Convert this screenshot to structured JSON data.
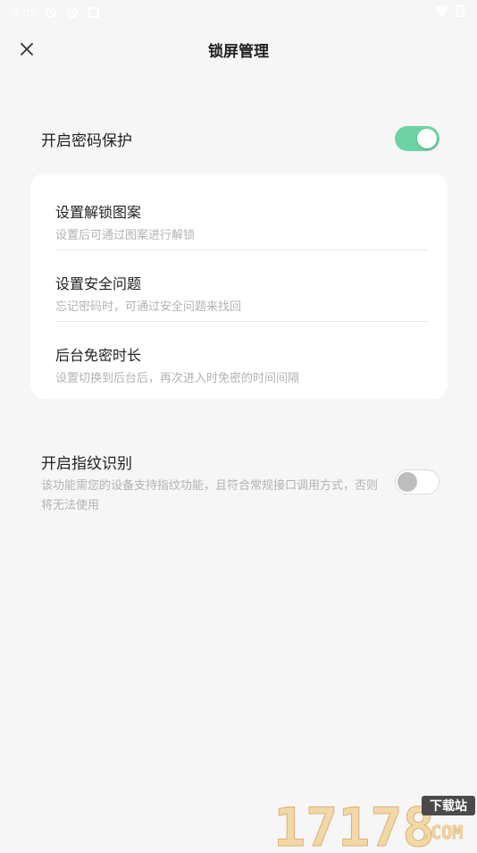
{
  "status_bar": {
    "time": "9:05"
  },
  "header": {
    "title": "锁屏管理"
  },
  "password_protection": {
    "label": "开启密码保护",
    "enabled": true
  },
  "card_items": [
    {
      "title": "设置解锁图案",
      "subtitle": "设置后可通过图案进行解锁"
    },
    {
      "title": "设置安全问题",
      "subtitle": "忘记密码时，可通过安全问题来找回"
    },
    {
      "title": "后台免密时长",
      "subtitle": "设置切换到后台后，再次进入时免密的时间间隔"
    }
  ],
  "fingerprint": {
    "label": "开启指纹识别",
    "description": "该功能需您的设备支持指纹功能，且符合常规接口调用方式，否则将无法使用",
    "enabled": false
  },
  "watermark": {
    "brand": "17178",
    "suffix": ".COM",
    "tag": "下载站"
  },
  "colors": {
    "accent": "#6dd3a4",
    "background": "#f6f6f6",
    "card": "#ffffff",
    "subtext": "#b3b3b3"
  }
}
